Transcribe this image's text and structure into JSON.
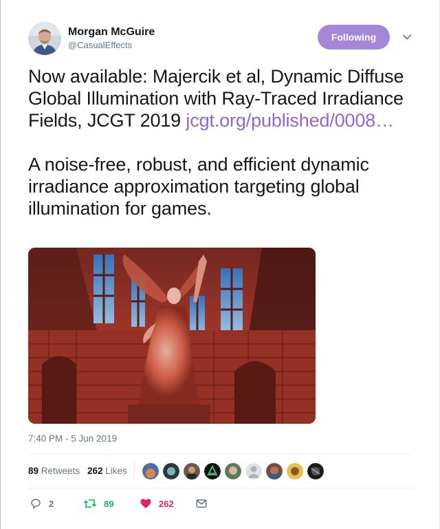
{
  "author": {
    "display_name": "Morgan McGuire",
    "handle": "@CasualEffects"
  },
  "follow_button": {
    "label": "Following"
  },
  "tweet": {
    "line1": "Now available: Majercik et al, Dynamic Diffuse Global Illumination with Ray-Traced Irradiance Fields, JCGT 2019 ",
    "link_text": "jcgt.org/published/0008…",
    "paragraph2": "A noise-free, robust, and efficient dynamic irradiance approximation targeting global illumination for games."
  },
  "timestamp": "7:40 PM - 5 Jun 2019",
  "stats": {
    "retweets_count": "89",
    "retweets_label": "Retweets",
    "likes_count": "262",
    "likes_label": "Likes"
  },
  "actions": {
    "reply_count": "2",
    "retweet_count": "89",
    "like_count": "262"
  },
  "colors": {
    "accent": "#9266cc",
    "follow_button_bg": "#a586d9",
    "retweet_green": "#17bf63",
    "like_red": "#e0245e",
    "muted_text": "#657786"
  },
  "icons": {
    "caret": "chevron-down-icon",
    "reply": "reply-icon",
    "retweet": "retweet-icon",
    "like": "heart-icon",
    "message": "mail-icon"
  }
}
